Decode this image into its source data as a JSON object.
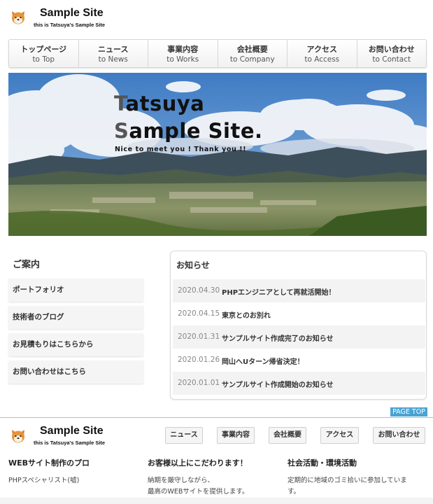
{
  "header": {
    "site_title": "Sample Site",
    "site_subtitle": "this is Tatsuya's Sample Site",
    "logo_icon": "dog-face-icon"
  },
  "nav": [
    {
      "jp": "トップページ",
      "en": "to Top"
    },
    {
      "jp": "ニュース",
      "en": "to News"
    },
    {
      "jp": "事業内容",
      "en": "to Works"
    },
    {
      "jp": "会社概要",
      "en": "to Company"
    },
    {
      "jp": "アクセス",
      "en": "to Access"
    },
    {
      "jp": "お問い合わせ",
      "en": "to Contact"
    }
  ],
  "hero": {
    "line1_cap": "T",
    "line1_rest": "atsuya",
    "line2_cap": "S",
    "line2_rest": "ample Site.",
    "subtitle": "Nice to meet you ! Thank you !!"
  },
  "guide": {
    "heading": "ご案内",
    "items": [
      "ポートフォリオ",
      "技術者のブログ",
      "お見積もりはこちらから",
      "お問い合わせはこちら"
    ]
  },
  "news": {
    "heading": "お知らせ",
    "items": [
      {
        "date": "2020.04.30",
        "title": "PHPエンジニアとして再就活開始！"
      },
      {
        "date": "2020.04.15",
        "title": "東京とのお別れ"
      },
      {
        "date": "2020.01.31",
        "title": "サンプルサイト作成完了のお知らせ"
      },
      {
        "date": "2020.01.26",
        "title": "岡山へUターン帰省決定！"
      },
      {
        "date": "2020.01.01",
        "title": "サンプルサイト作成開始のお知らせ"
      }
    ]
  },
  "page_top": "PAGE TOP",
  "footer": {
    "site_title": "Sample Site",
    "site_subtitle": "this is Tatsuya's Sample Site",
    "nav": [
      "ニュース",
      "事業内容",
      "会社概要",
      "アクセス",
      "お問い合わせ"
    ],
    "columns": [
      {
        "heading": "WEBサイト制作のプロ",
        "lines": [
          "PHPスペシャリスト(嘘)"
        ]
      },
      {
        "heading": "お客様以上にこだわります！",
        "lines": [
          "納期を厳守しながら、",
          "最高のWEBサイトを提供します。"
        ]
      },
      {
        "heading": "社会活動・環境活動",
        "lines": [
          "定期的に地域のゴミ拾いに参加していま",
          "す。"
        ]
      }
    ]
  },
  "colors": {
    "accent": "#4aa3d3",
    "sky": "#4a86c8"
  }
}
